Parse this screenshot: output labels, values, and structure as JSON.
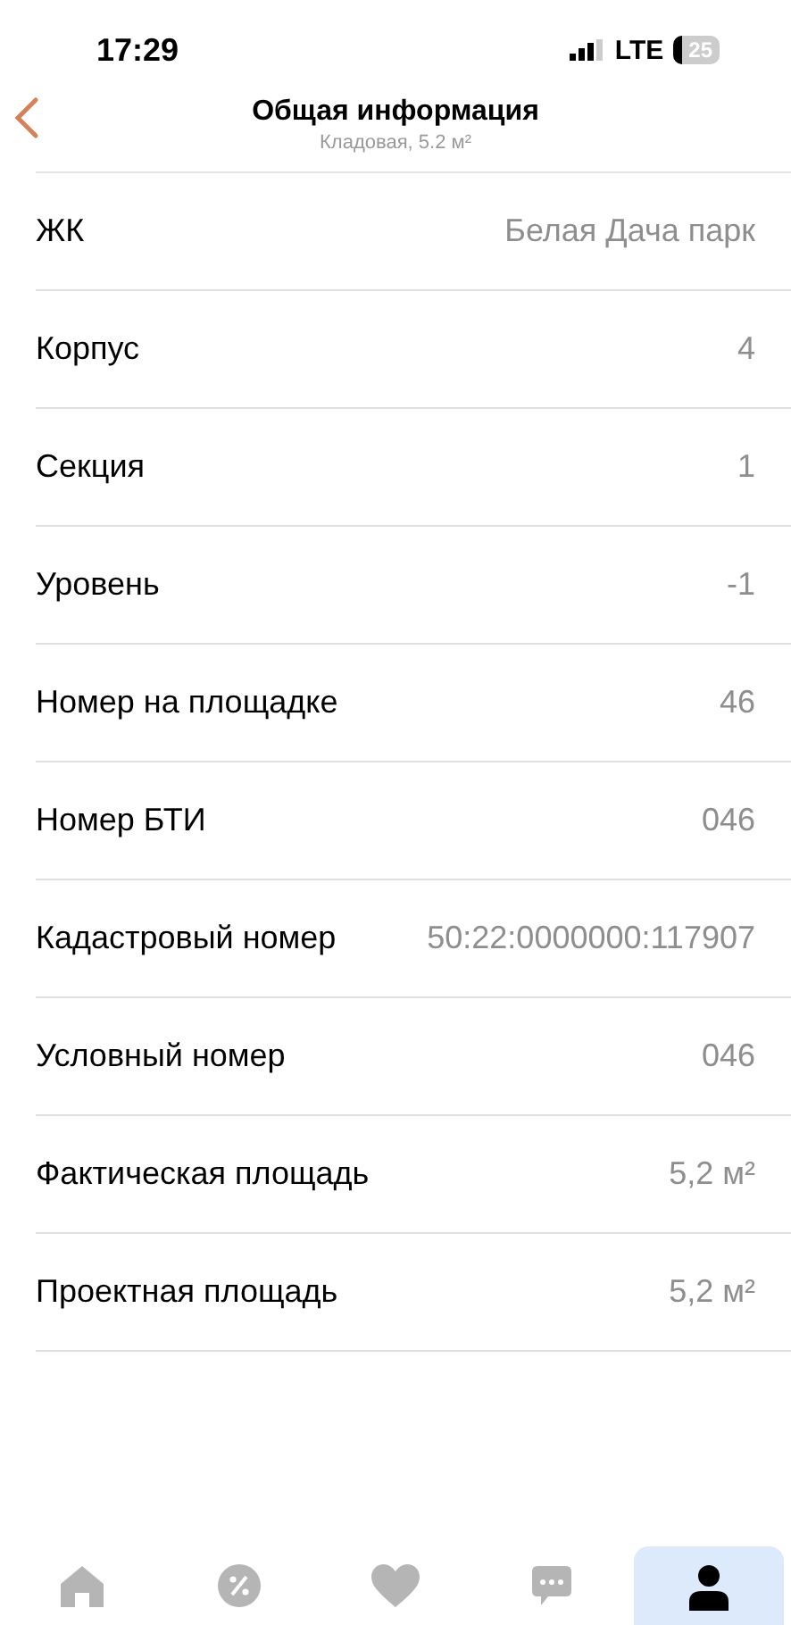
{
  "status_bar": {
    "time": "17:29",
    "network": "LTE",
    "battery": "25"
  },
  "header": {
    "title": "Общая информация",
    "subtitle": "Кладовая, 5.2 м²"
  },
  "rows": [
    {
      "label": "ЖК",
      "value": "Белая Дача парк"
    },
    {
      "label": "Корпус",
      "value": "4"
    },
    {
      "label": "Секция",
      "value": "1"
    },
    {
      "label": "Уровень",
      "value": "-1"
    },
    {
      "label": "Номер на площадке",
      "value": "46"
    },
    {
      "label": "Номер БТИ",
      "value": "046"
    },
    {
      "label": "Кадастровый номер",
      "value": "50:22:0000000:117907"
    },
    {
      "label": "Условный номер",
      "value": "046"
    },
    {
      "label": "Фактическая площадь",
      "value": "5,2 м²"
    },
    {
      "label": "Проектная площадь",
      "value": "5,2 м²"
    }
  ],
  "tab_bar": [
    {
      "kind": "home",
      "selected": false
    },
    {
      "kind": "discount",
      "selected": false
    },
    {
      "kind": "favorites",
      "selected": false
    },
    {
      "kind": "chat",
      "selected": false
    },
    {
      "kind": "profile",
      "selected": true
    }
  ]
}
